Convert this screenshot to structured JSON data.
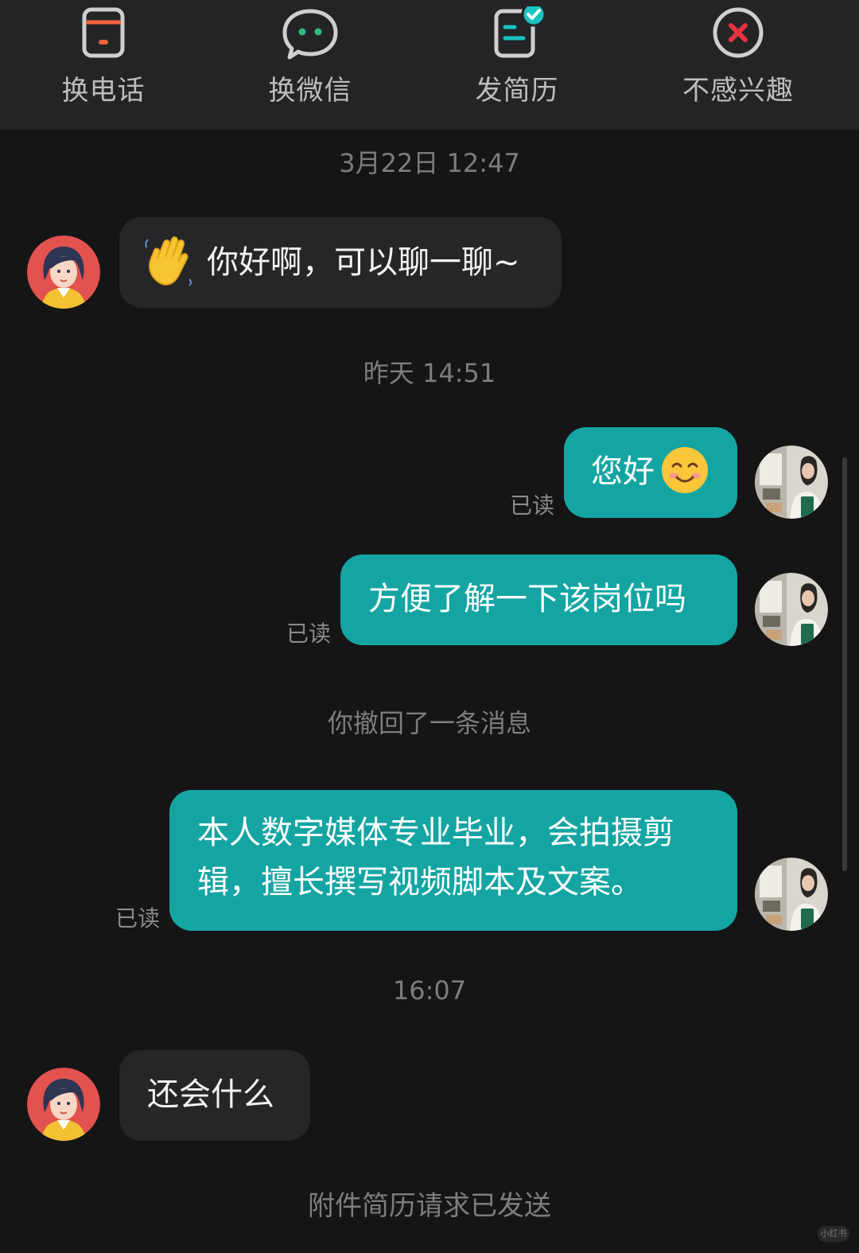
{
  "toolbar": {
    "items": [
      {
        "label": "换电话",
        "icon": "phone-card-icon",
        "color": "#f0643c"
      },
      {
        "label": "换微信",
        "icon": "wechat-icon",
        "color": "#2bbf7a"
      },
      {
        "label": "发简历",
        "icon": "resume-sent-icon",
        "color": "#19c3c0"
      },
      {
        "label": "不感兴趣",
        "icon": "close-circle-icon",
        "color": "#e8323c"
      }
    ]
  },
  "chat": {
    "timestamps": {
      "t1": "3月22日 12:47",
      "t2": "昨天 14:51",
      "t3": "16:07"
    },
    "messages": {
      "m1": "你好啊，可以聊一聊~",
      "m2": "您好",
      "m3": "方便了解一下该岗位吗",
      "m4_line1": "本人数字媒体专业毕业，会拍摄剪",
      "m4_line2": "辑，擅长撰写视频脚本及文案。",
      "m5": "还会什么"
    },
    "read_label": "已读",
    "system": {
      "recall": "你撤回了一条消息",
      "resume_request": "附件简历请求已发送"
    }
  },
  "colors": {
    "background": "#151516",
    "outgoing_bubble": "#14a5a3",
    "incoming_bubble": "#262629",
    "toolbar": "#242427"
  },
  "watermark": "小红书"
}
